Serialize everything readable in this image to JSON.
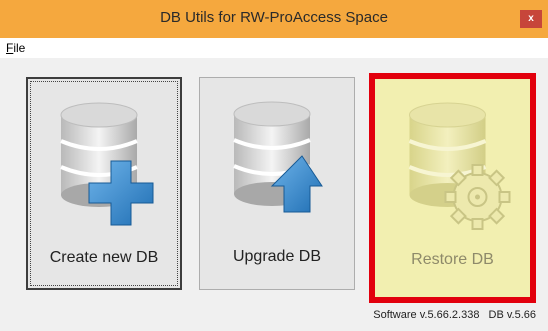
{
  "window": {
    "title": "DB Utils for RW-ProAccess Space",
    "close_label": "x"
  },
  "menu": {
    "file_label": "File"
  },
  "tiles": {
    "create": {
      "label": "Create new DB",
      "icon": "database-plus-icon"
    },
    "upgrade": {
      "label": "Upgrade DB",
      "icon": "database-arrow-up-icon"
    },
    "restore": {
      "label": "Restore DB",
      "icon": "database-gear-icon"
    }
  },
  "status": {
    "software_version": "Software v.5.66.2.338",
    "db_version": "DB v.5.66"
  },
  "colors": {
    "titlebar": "#f5a83e",
    "close_button": "#c7463a",
    "restore_highlight_border": "#e2000d",
    "restore_background": "#f2efb0",
    "icon_blue": "#3f8fd0"
  }
}
